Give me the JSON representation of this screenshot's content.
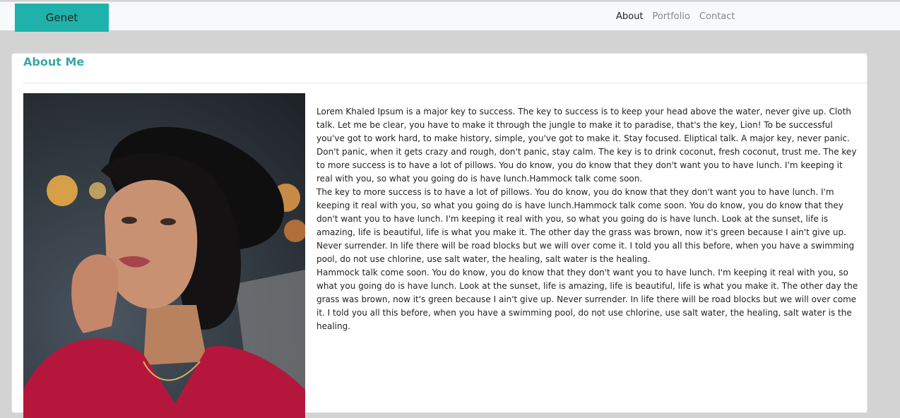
{
  "navbar": {
    "brand": "Genet",
    "links": [
      {
        "label": "About",
        "active": true
      },
      {
        "label": "Portfolio",
        "active": false
      },
      {
        "label": "Contact",
        "active": false
      }
    ]
  },
  "about": {
    "title": "About Me",
    "paragraphs": [
      "Lorem Khaled Ipsum is a major key to success. The key to success is to keep your head above the water, never give up. Cloth talk. Let me be clear, you have to make it through the jungle to make it to paradise, that's the key, Lion! To be successful you've got to work hard, to make history, simple, you've got to make it. Stay focused. Eliptical talk. A major key, never panic. Don't panic, when it gets crazy and rough, don't panic, stay calm. The key is to drink coconut, fresh coconut, trust me. The key to more success is to have a lot of pillows. You do know, you do know that they don't want you to have lunch. I'm keeping it real with you, so what you going do is have lunch.Hammock talk come soon.",
      "The key to more success is to have a lot of pillows. You do know, you do know that they don't want you to have lunch. I'm keeping it real with you, so what you going do is have lunch.Hammock talk come soon. You do know, you do know that they don't want you to have lunch. I'm keeping it real with you, so what you going do is have lunch. Look at the sunset, life is amazing, life is beautiful, life is what you make it. The other day the grass was brown, now it's green because I ain't give up. Never surrender. In life there will be road blocks but we will over come it. I told you all this before, when you have a swimming pool, do not use chlorine, use salt water, the healing, salt water is the healing.",
      "Hammock talk come soon. You do know, you do know that they don't want you to have lunch. I'm keeping it real with you, so what you going do is have lunch. Look at the sunset, life is amazing, life is beautiful, life is what you make it. The other day the grass was brown, now it's green because I ain't give up. Never surrender. In life there will be road blocks but we will over come it. I told you all this before, when you have a swimming pool, do not use chlorine, use salt water, the healing, salt water is the healing."
    ]
  },
  "colors": {
    "brand_bg": "#20b2aa",
    "title": "#3aa9a3",
    "page_bg": "#d3d3d3"
  }
}
